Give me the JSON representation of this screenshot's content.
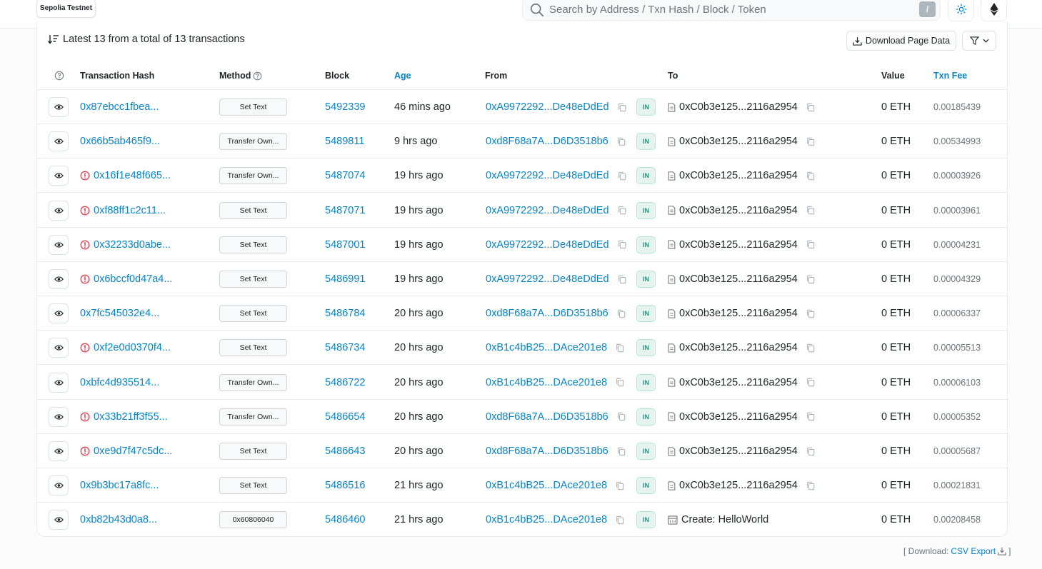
{
  "header": {
    "network": "Sepolia Testnet",
    "search_placeholder": "Search by Address / Txn Hash / Block / Token",
    "search_shortcut": "/"
  },
  "summary": {
    "text": "Latest 13 from a total of 13 transactions",
    "download_label": "Download Page Data"
  },
  "columns": {
    "hash": "Transaction Hash",
    "method": "Method",
    "block": "Block",
    "age": "Age",
    "from": "From",
    "to": "To",
    "value": "Value",
    "fee": "Txn Fee"
  },
  "transactions": [
    {
      "hash": "0x87ebcc1fbea...",
      "error": false,
      "method": "Set Text",
      "block": "5492339",
      "age": "46 mins ago",
      "from": "0xA9972292...De48eDdEd",
      "direction": "IN",
      "to": "0xC0b3e125...2116a2954",
      "to_type": "contract",
      "value": "0 ETH",
      "fee": "0.00185439"
    },
    {
      "hash": "0x66b5ab465f9...",
      "error": false,
      "method": "Transfer Own...",
      "block": "5489811",
      "age": "9 hrs ago",
      "from": "0xd8F68a7A...D6D3518b6",
      "direction": "IN",
      "to": "0xC0b3e125...2116a2954",
      "to_type": "contract",
      "value": "0 ETH",
      "fee": "0.00534993"
    },
    {
      "hash": "0x16f1e48f665...",
      "error": true,
      "method": "Transfer Own...",
      "block": "5487074",
      "age": "19 hrs ago",
      "from": "0xA9972292...De48eDdEd",
      "direction": "IN",
      "to": "0xC0b3e125...2116a2954",
      "to_type": "contract",
      "value": "0 ETH",
      "fee": "0.00003926"
    },
    {
      "hash": "0xf88ff1c2c11...",
      "error": true,
      "method": "Set Text",
      "block": "5487071",
      "age": "19 hrs ago",
      "from": "0xA9972292...De48eDdEd",
      "direction": "IN",
      "to": "0xC0b3e125...2116a2954",
      "to_type": "contract",
      "value": "0 ETH",
      "fee": "0.00003961"
    },
    {
      "hash": "0x32233d0abe...",
      "error": true,
      "method": "Set Text",
      "block": "5487001",
      "age": "19 hrs ago",
      "from": "0xA9972292...De48eDdEd",
      "direction": "IN",
      "to": "0xC0b3e125...2116a2954",
      "to_type": "contract",
      "value": "0 ETH",
      "fee": "0.00004231"
    },
    {
      "hash": "0x6bccf0d47a4...",
      "error": true,
      "method": "Set Text",
      "block": "5486991",
      "age": "19 hrs ago",
      "from": "0xA9972292...De48eDdEd",
      "direction": "IN",
      "to": "0xC0b3e125...2116a2954",
      "to_type": "contract",
      "value": "0 ETH",
      "fee": "0.00004329"
    },
    {
      "hash": "0x7fc545032e4...",
      "error": false,
      "method": "Set Text",
      "block": "5486784",
      "age": "20 hrs ago",
      "from": "0xd8F68a7A...D6D3518b6",
      "direction": "IN",
      "to": "0xC0b3e125...2116a2954",
      "to_type": "contract",
      "value": "0 ETH",
      "fee": "0.00006337"
    },
    {
      "hash": "0xf2e0d0370f4...",
      "error": true,
      "method": "Set Text",
      "block": "5486734",
      "age": "20 hrs ago",
      "from": "0xB1c4bB25...DAce201e8",
      "direction": "IN",
      "to": "0xC0b3e125...2116a2954",
      "to_type": "contract",
      "value": "0 ETH",
      "fee": "0.00005513"
    },
    {
      "hash": "0xbfc4d935514...",
      "error": false,
      "method": "Transfer Own...",
      "block": "5486722",
      "age": "20 hrs ago",
      "from": "0xB1c4bB25...DAce201e8",
      "direction": "IN",
      "to": "0xC0b3e125...2116a2954",
      "to_type": "contract",
      "value": "0 ETH",
      "fee": "0.00006103"
    },
    {
      "hash": "0x33b21ff3f55...",
      "error": true,
      "method": "Transfer Own...",
      "block": "5486654",
      "age": "20 hrs ago",
      "from": "0xd8F68a7A...D6D3518b6",
      "direction": "IN",
      "to": "0xC0b3e125...2116a2954",
      "to_type": "contract",
      "value": "0 ETH",
      "fee": "0.00005352"
    },
    {
      "hash": "0xe9d7f47c5dc...",
      "error": true,
      "method": "Set Text",
      "block": "5486643",
      "age": "20 hrs ago",
      "from": "0xd8F68a7A...D6D3518b6",
      "direction": "IN",
      "to": "0xC0b3e125...2116a2954",
      "to_type": "contract",
      "value": "0 ETH",
      "fee": "0.00005687"
    },
    {
      "hash": "0x9b3bc17a8fc...",
      "error": false,
      "method": "Set Text",
      "block": "5486516",
      "age": "21 hrs ago",
      "from": "0xB1c4bB25...DAce201e8",
      "direction": "IN",
      "to": "0xC0b3e125...2116a2954",
      "to_type": "contract",
      "value": "0 ETH",
      "fee": "0.00021831"
    },
    {
      "hash": "0xb82b43d0a8...",
      "error": false,
      "method": "0x60806040",
      "block": "5486460",
      "age": "21 hrs ago",
      "from": "0xB1c4bB25...DAce201e8",
      "direction": "IN",
      "to": "Create: HelloWorld",
      "to_type": "create",
      "value": "0 ETH",
      "fee": "0.00208458"
    }
  ],
  "footer": {
    "prefix": "[ Download:",
    "csv_label": "CSV Export",
    "suffix": "]"
  },
  "colors": {
    "link": "#0784c3",
    "error": "#dc3545",
    "in_badge_bg": "#e6f4ef",
    "in_badge_text": "#00a186"
  }
}
